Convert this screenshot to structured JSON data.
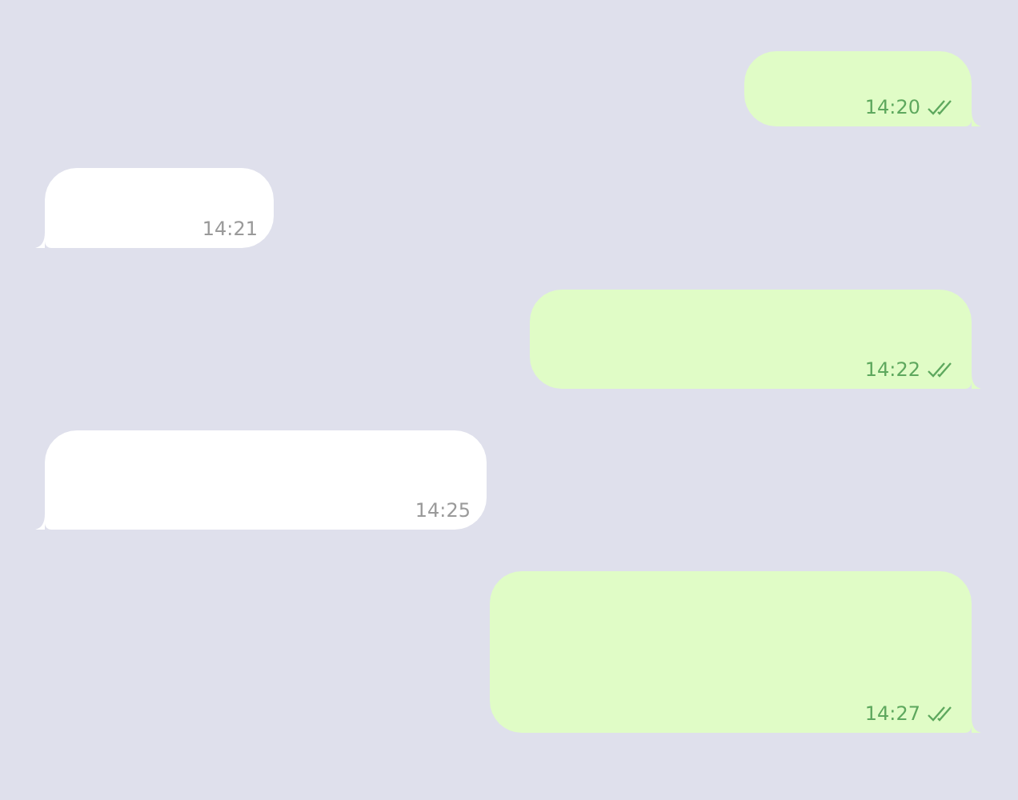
{
  "messages": [
    {
      "kind": "outgoing",
      "time": "14:20",
      "read": true
    },
    {
      "kind": "incoming",
      "time": "14:21"
    },
    {
      "kind": "outgoing",
      "time": "14:22",
      "read": true
    },
    {
      "kind": "incoming",
      "time": "14:25"
    },
    {
      "kind": "outgoing",
      "time": "14:27",
      "read": true
    }
  ]
}
